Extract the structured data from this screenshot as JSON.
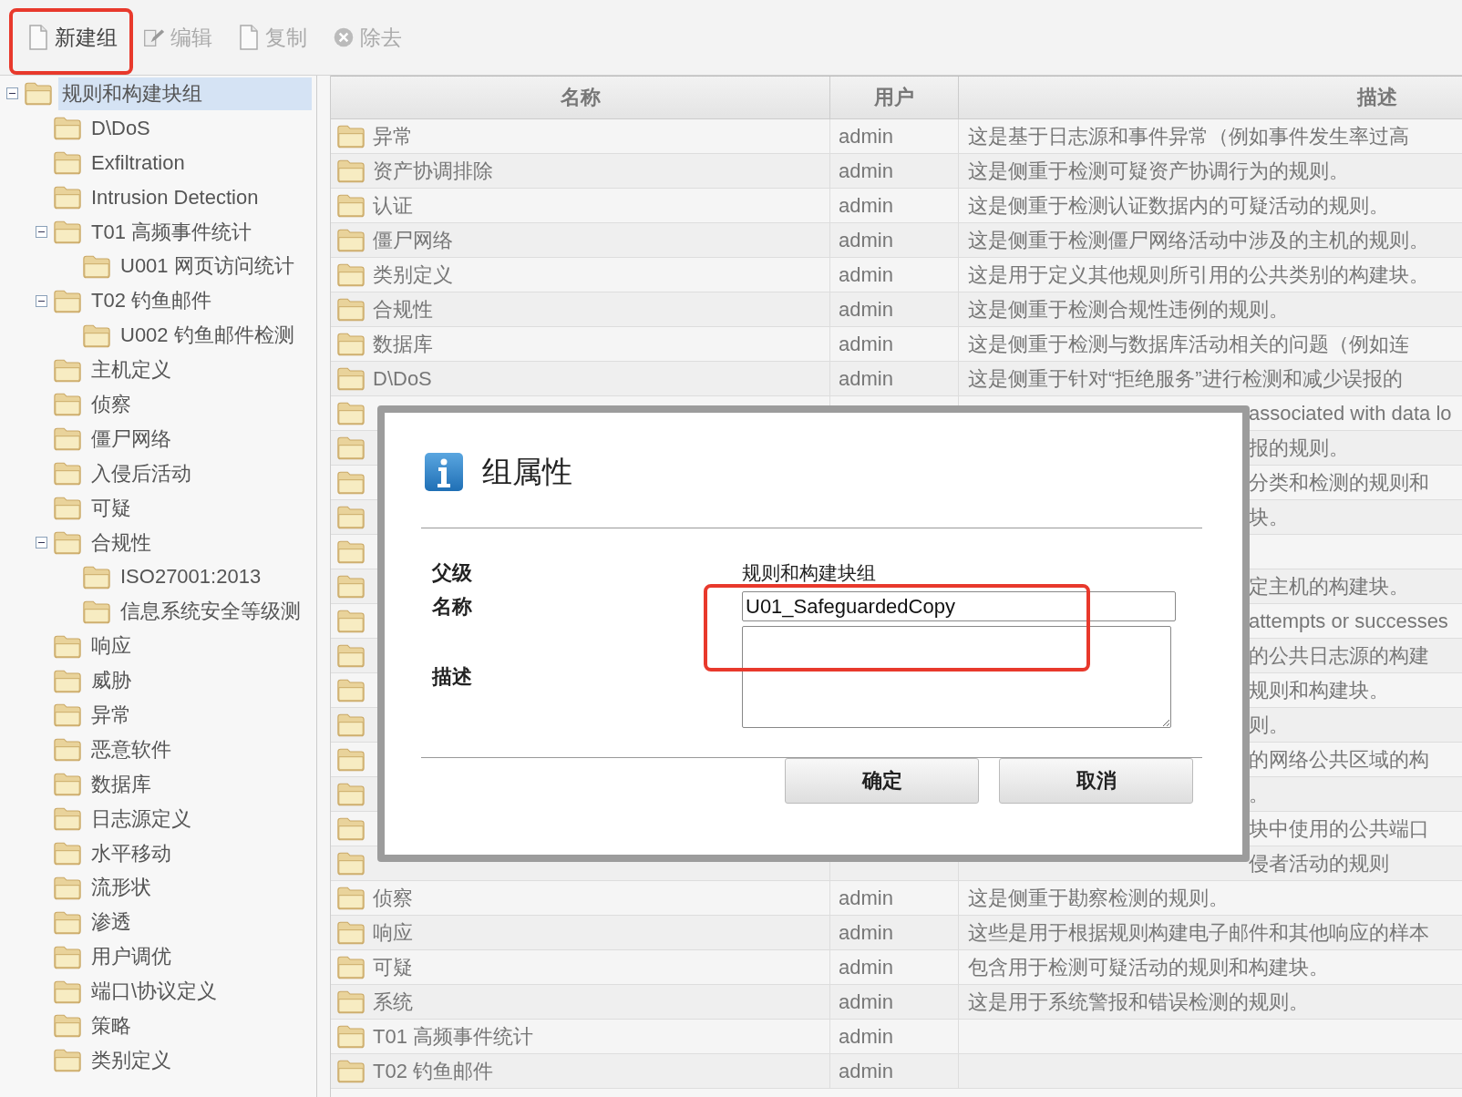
{
  "toolbar": {
    "buttons": [
      {
        "label": "新建组",
        "kind": "new",
        "disabled": false,
        "highlighted": true
      },
      {
        "label": "编辑",
        "kind": "edit",
        "disabled": true,
        "highlighted": false
      },
      {
        "label": "复制",
        "kind": "copy",
        "disabled": true,
        "highlighted": false
      },
      {
        "label": "除去",
        "kind": "remove",
        "disabled": true,
        "highlighted": false
      }
    ]
  },
  "tree": {
    "items": [
      {
        "label": "规则和构建块组",
        "selected": true,
        "expanded": true,
        "children": [
          {
            "label": "D\\DoS",
            "selected": false
          },
          {
            "label": "Exfiltration",
            "selected": false
          },
          {
            "label": "Intrusion Detection",
            "selected": false
          },
          {
            "label": "T01 高频事件统计",
            "selected": false,
            "expanded": true,
            "children": [
              {
                "label": "U001 网页访问统计",
                "selected": false
              }
            ]
          },
          {
            "label": "T02 钓鱼邮件",
            "selected": false,
            "expanded": true,
            "children": [
              {
                "label": "U002 钓鱼邮件检测",
                "selected": false
              }
            ]
          },
          {
            "label": "主机定义",
            "selected": false
          },
          {
            "label": "侦察",
            "selected": false
          },
          {
            "label": "僵尸网络",
            "selected": false
          },
          {
            "label": "入侵后活动",
            "selected": false
          },
          {
            "label": "可疑",
            "selected": false
          },
          {
            "label": "合规性",
            "selected": false,
            "expanded": true,
            "children": [
              {
                "label": "ISO27001:2013",
                "selected": false
              },
              {
                "label": "信息系统安全等级测",
                "selected": false
              }
            ]
          },
          {
            "label": "响应",
            "selected": false
          },
          {
            "label": "威胁",
            "selected": false
          },
          {
            "label": "异常",
            "selected": false
          },
          {
            "label": "恶意软件",
            "selected": false
          },
          {
            "label": "数据库",
            "selected": false
          },
          {
            "label": "日志源定义",
            "selected": false
          },
          {
            "label": "水平移动",
            "selected": false
          },
          {
            "label": "流形状",
            "selected": false
          },
          {
            "label": "渗透",
            "selected": false
          },
          {
            "label": "用户调优",
            "selected": false
          },
          {
            "label": "端口\\协议定义",
            "selected": false
          },
          {
            "label": "策略",
            "selected": false
          },
          {
            "label": "类别定义",
            "selected": false
          }
        ]
      }
    ]
  },
  "table": {
    "columns": [
      "名称",
      "用户",
      "描述"
    ],
    "rows": [
      {
        "kind": "row",
        "name": "异常",
        "user": "admin",
        "description": "这是基于日志源和事件异常（例如事件发生率过高"
      },
      {
        "kind": "row",
        "name": "资产协调排除",
        "user": "admin",
        "description": "这是侧重于检测可疑资产协调行为的规则。"
      },
      {
        "kind": "row",
        "name": "认证",
        "user": "admin",
        "description": "这是侧重于检测认证数据内的可疑活动的规则。"
      },
      {
        "kind": "row",
        "name": "僵尸网络",
        "user": "admin",
        "description": "这是侧重于检测僵尸网络活动中涉及的主机的规则。"
      },
      {
        "kind": "row",
        "name": "类别定义",
        "user": "admin",
        "description": "这是用于定义其他规则所引用的公共类别的构建块。"
      },
      {
        "kind": "row",
        "name": "合规性",
        "user": "admin",
        "description": "这是侧重于检测合规性违例的规则。"
      },
      {
        "kind": "row",
        "name": "数据库",
        "user": "admin",
        "description": "这是侧重于检测与数据库活动相关的问题（例如连"
      },
      {
        "kind": "row",
        "name": "D\\DoS",
        "user": "admin",
        "description": "这是侧重于针对“拒绝服务”进行检测和减少误报的"
      },
      {
        "kind": "covered",
        "description": "associated with data lo"
      },
      {
        "kind": "covered",
        "description": "报的规则。"
      },
      {
        "kind": "covered",
        "description": "分类和检测的规则和"
      },
      {
        "kind": "covered",
        "description": "块。"
      },
      {
        "kind": "covered"
      },
      {
        "kind": "covered",
        "description": "定主机的构建块。"
      },
      {
        "kind": "covered",
        "description": "attempts or successes"
      },
      {
        "kind": "covered",
        "description": "的公共日志源的构建"
      },
      {
        "kind": "covered",
        "description": "规则和构建块。"
      },
      {
        "kind": "covered",
        "description": "则。"
      },
      {
        "kind": "covered",
        "description": "的网络公共区域的构"
      },
      {
        "kind": "covered",
        "description": "。"
      },
      {
        "kind": "covered",
        "description": "块中使用的公共端口"
      },
      {
        "kind": "covered",
        "description": "侵者活动的规则"
      },
      {
        "kind": "row",
        "name": "侦察",
        "user": "admin",
        "description": "这是侧重于勘察检测的规则。"
      },
      {
        "kind": "row",
        "name": "响应",
        "user": "admin",
        "description": "这些是用于根据规则构建电子邮件和其他响应的样本"
      },
      {
        "kind": "row",
        "name": "可疑",
        "user": "admin",
        "description": "包含用于检测可疑活动的规则和构建块。"
      },
      {
        "kind": "row",
        "name": "系统",
        "user": "admin",
        "description": "这是用于系统警报和错误检测的规则。"
      },
      {
        "kind": "row",
        "name": "T01 高频事件统计",
        "user": "admin"
      },
      {
        "kind": "row",
        "name": "T02 钓鱼邮件",
        "user": "admin"
      }
    ]
  },
  "dialog": {
    "title": "组属性",
    "fields": [
      {
        "kind": "text",
        "label": "父级",
        "value": "规则和构建块组"
      },
      {
        "kind": "input",
        "label": "名称",
        "value": "U01_SafeguardedCopy",
        "highlighted": true
      },
      {
        "kind": "textarea",
        "label": "描述"
      }
    ],
    "buttons": [
      "确定",
      "取消"
    ]
  }
}
